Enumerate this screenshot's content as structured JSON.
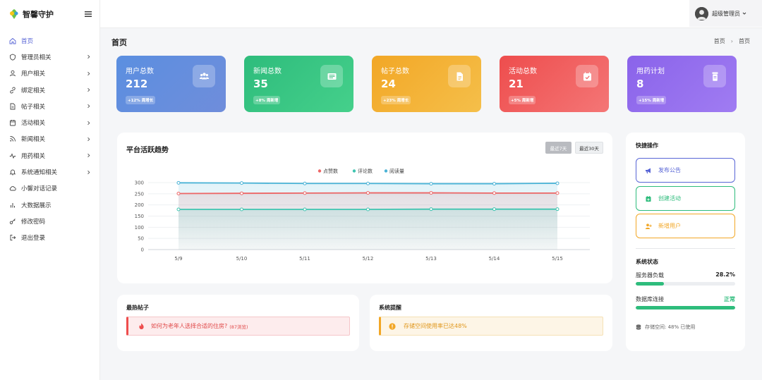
{
  "app": {
    "title": "智馨守护"
  },
  "header": {
    "user_name": "超级管理员"
  },
  "page": {
    "title": "首页",
    "breadcrumb": [
      "首页",
      "首页"
    ]
  },
  "sidebar": {
    "items": [
      {
        "label": "首页",
        "icon": "home-icon",
        "has_arrow": false,
        "active": true
      },
      {
        "label": "管理员相关",
        "icon": "shield-icon",
        "has_arrow": true
      },
      {
        "label": "用户相关",
        "icon": "user-icon",
        "has_arrow": true
      },
      {
        "label": "绑定相关",
        "icon": "link-icon",
        "has_arrow": true
      },
      {
        "label": "帖子相关",
        "icon": "file-icon",
        "has_arrow": true
      },
      {
        "label": "活动相关",
        "icon": "calendar-icon",
        "has_arrow": true
      },
      {
        "label": "新闻相关",
        "icon": "rss-icon",
        "has_arrow": true
      },
      {
        "label": "用药相关",
        "icon": "pulse-icon",
        "has_arrow": true
      },
      {
        "label": "系统通知相关",
        "icon": "bell-icon",
        "has_arrow": true
      },
      {
        "label": "小馨对话记录",
        "icon": "cloud-icon",
        "has_arrow": false
      },
      {
        "label": "大数据展示",
        "icon": "bar-chart-icon",
        "has_arrow": false
      },
      {
        "label": "修改密码",
        "icon": "key-icon",
        "has_arrow": false
      },
      {
        "label": "退出登录",
        "icon": "logout-icon",
        "has_arrow": false
      }
    ]
  },
  "stats": [
    {
      "label": "用户总数",
      "value": "212",
      "badge": "+12% 周增长",
      "icon": "users-icon",
      "color_from": "#5b8fe0",
      "color_to": "#6f8ddb"
    },
    {
      "label": "新闻总数",
      "value": "35",
      "badge": "+8% 周新增",
      "icon": "newspaper-icon",
      "color_from": "#2ebc7c",
      "color_to": "#45d08b"
    },
    {
      "label": "帖子总数",
      "value": "24",
      "badge": "+23% 周增长",
      "icon": "document-icon",
      "color_from": "#f2a726",
      "color_to": "#f5bf4a"
    },
    {
      "label": "活动总数",
      "value": "21",
      "badge": "+5% 周新增",
      "icon": "calendar-check-icon",
      "color_from": "#ee4d4d",
      "color_to": "#f47676"
    },
    {
      "label": "用药计划",
      "value": "8",
      "badge": "+15% 周新增",
      "icon": "pill-bottle-icon",
      "color_from": "#8a63ea",
      "color_to": "#a07cf2"
    }
  ],
  "trend": {
    "title": "平台活跃趋势",
    "range_buttons": [
      {
        "label": "最近7天",
        "active": true
      },
      {
        "label": "最近30天",
        "active": false
      }
    ]
  },
  "chart_data": {
    "type": "area",
    "categories": [
      "5/9",
      "5/10",
      "5/11",
      "5/12",
      "5/13",
      "5/14",
      "5/15"
    ],
    "series": [
      {
        "name": "点赞数",
        "color": "#ee6666",
        "values": [
          251,
          252,
          253,
          254,
          254,
          253,
          253
        ]
      },
      {
        "name": "评论数",
        "color": "#3fc4b0",
        "values": [
          180,
          180,
          180,
          180,
          181,
          181,
          181
        ]
      },
      {
        "name": "阅读量",
        "color": "#4ab3d6",
        "values": [
          299,
          298,
          296,
          296,
          295,
          295,
          297
        ]
      }
    ],
    "ylim": [
      0,
      300
    ],
    "yticks": [
      "0",
      "50",
      "100",
      "150",
      "200",
      "250",
      "300"
    ],
    "legend": "top-center",
    "grid": true
  },
  "hot_posts": {
    "title": "最热帖子",
    "item_title": "如何为老年人选择合适的住房?",
    "item_views": "(87浏览)"
  },
  "reminders": {
    "title": "系统提醒",
    "message": "存储空间使用率已达48%"
  },
  "quick_actions": {
    "title": "快捷操作",
    "buttons": [
      {
        "label": "发布公告",
        "icon": "megaphone-icon",
        "color": "#5865d6"
      },
      {
        "label": "创建活动",
        "icon": "calendar-plus-icon",
        "color": "#2ebc7c"
      },
      {
        "label": "新增用户",
        "icon": "user-plus-icon",
        "color": "#f2a726"
      }
    ]
  },
  "system_status": {
    "title": "系统状态",
    "server_load_label": "服务器负载",
    "server_load_value": "28.2%",
    "server_load_fraction": 0.282,
    "db_label": "数据库连接",
    "db_value": "正常",
    "db_fraction": 1.0,
    "storage_text": "存储空间: 48% 已使用",
    "accent": "#2ebc7c"
  }
}
